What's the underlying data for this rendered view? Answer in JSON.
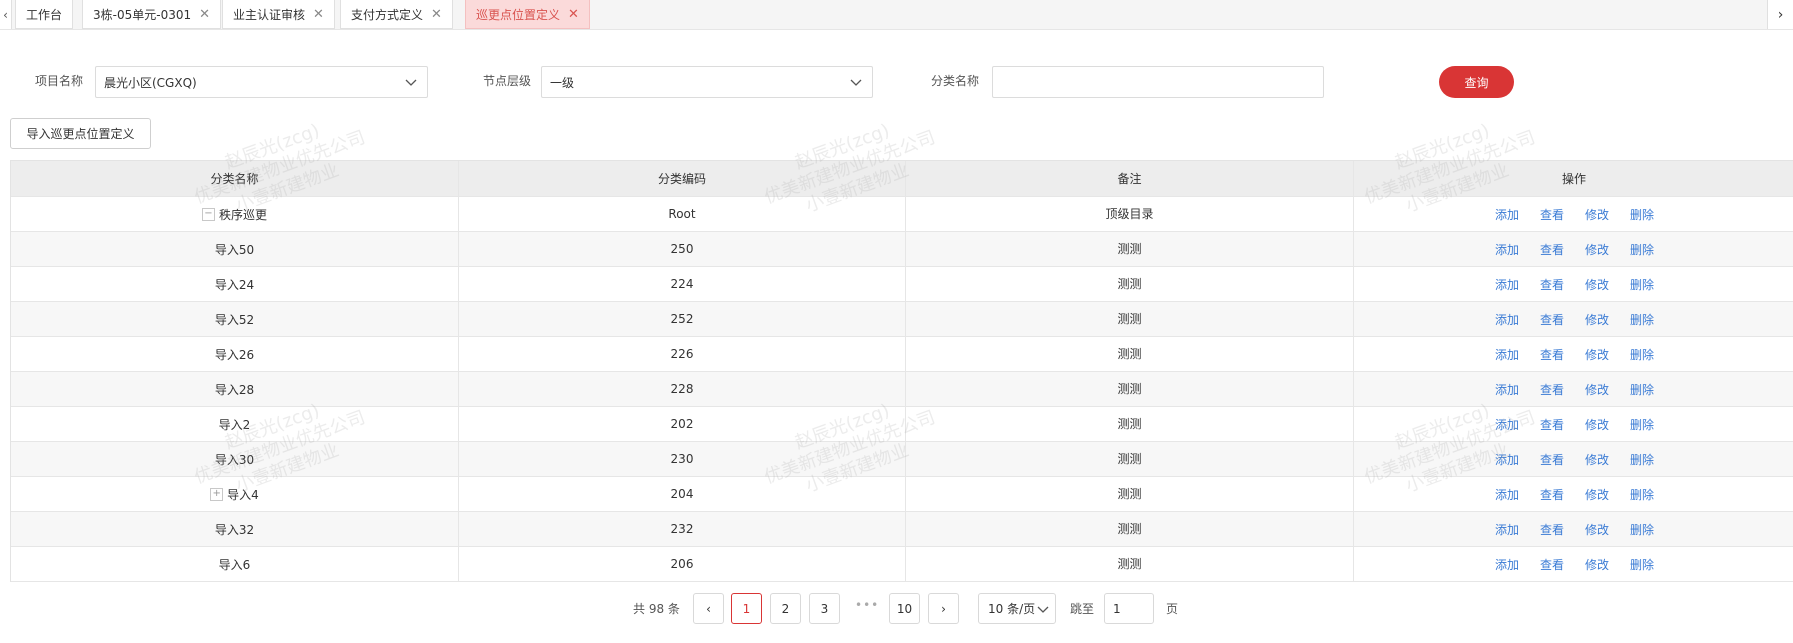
{
  "tabs": [
    {
      "label": "工作台",
      "closable": false,
      "active": false
    },
    {
      "label": "3栋-05单元-0301",
      "closable": true,
      "active": false
    },
    {
      "label": "业主认证审核",
      "closable": true,
      "active": false
    },
    {
      "label": "支付方式定义",
      "closable": true,
      "active": false
    },
    {
      "label": "巡更点位置定义",
      "closable": true,
      "active": true
    }
  ],
  "icons": {
    "close": "✕",
    "scroll_left": "‹",
    "scroll_right": "›"
  },
  "filters": {
    "project_label": "项目名称",
    "project_value": "晨光小区(CGXQ)",
    "level_label": "节点层级",
    "level_value": "一级",
    "category_label": "分类名称",
    "category_value": "",
    "query_button": "查询"
  },
  "import_button": "导入巡更点位置定义",
  "table": {
    "headers": [
      "分类名称",
      "分类编码",
      "备注",
      "操作"
    ],
    "rows": [
      {
        "name": "秩序巡更",
        "code": "Root",
        "note": "顶级目录",
        "expander": "−"
      },
      {
        "name": "导入50",
        "code": "250",
        "note": "测测",
        "expander": ""
      },
      {
        "name": "导入24",
        "code": "224",
        "note": "测测",
        "expander": ""
      },
      {
        "name": "导入52",
        "code": "252",
        "note": "测测",
        "expander": ""
      },
      {
        "name": "导入26",
        "code": "226",
        "note": "测测",
        "expander": ""
      },
      {
        "name": "导入28",
        "code": "228",
        "note": "测测",
        "expander": ""
      },
      {
        "name": "导入2",
        "code": "202",
        "note": "测测",
        "expander": ""
      },
      {
        "name": "导入30",
        "code": "230",
        "note": "测测",
        "expander": ""
      },
      {
        "name": "导入4",
        "code": "204",
        "note": "测测",
        "expander": "+"
      },
      {
        "name": "导入32",
        "code": "232",
        "note": "测测",
        "expander": ""
      },
      {
        "name": "导入6",
        "code": "206",
        "note": "测测",
        "expander": ""
      }
    ],
    "actions": [
      "添加",
      "查看",
      "修改",
      "删除"
    ]
  },
  "pagination": {
    "total_text": "共 98 条",
    "prev": "‹",
    "next": "›",
    "pages": [
      "1",
      "2",
      "3"
    ],
    "ellipsis": "•••",
    "last_page": "10",
    "current": "1",
    "page_size": "10 条/页",
    "jump_label": "跳至",
    "jump_value": "1",
    "page_suffix": "页"
  },
  "watermark": {
    "line1": "赵辰光(zcg)",
    "line2": "优美新建物业优先公司",
    "line3": "小壹新建物业"
  },
  "colors": {
    "accent": "#d93535",
    "link": "#3a7bd5",
    "active_tab_bg": "#fbdada"
  }
}
